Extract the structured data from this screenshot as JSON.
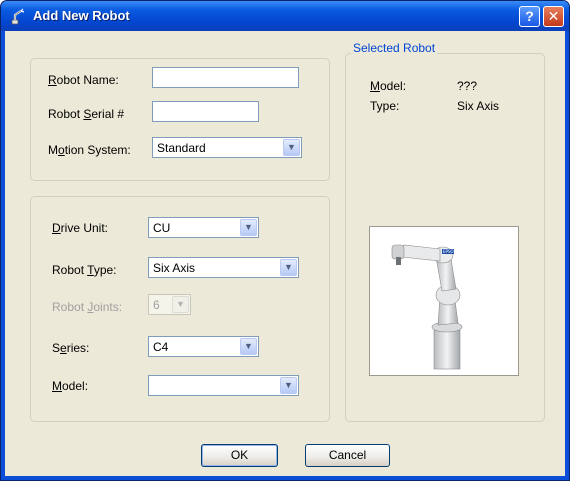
{
  "window": {
    "title": "Add New Robot",
    "help_glyph": "?",
    "close_glyph": "✕"
  },
  "form": {
    "robot_name": {
      "label_pre": "",
      "label_u": "R",
      "label_post": "obot Name:",
      "value": ""
    },
    "robot_serial": {
      "label_pre": "Robot ",
      "label_u": "S",
      "label_post": "erial #",
      "value": ""
    },
    "motion_system": {
      "label_pre": "M",
      "label_u": "o",
      "label_post": "tion System:",
      "value": "Standard"
    },
    "drive_unit": {
      "label_pre": "",
      "label_u": "D",
      "label_post": "rive Unit:",
      "value": "CU"
    },
    "robot_type": {
      "label_pre": "Robot ",
      "label_u": "T",
      "label_post": "ype:",
      "value": "Six Axis"
    },
    "robot_joints": {
      "label_pre": "Robot ",
      "label_u": "J",
      "label_post": "oints:",
      "value": "6"
    },
    "series": {
      "label_pre": "S",
      "label_u": "e",
      "label_post": "ries:",
      "value": "C4"
    },
    "model": {
      "label_pre": "",
      "label_u": "M",
      "label_post": "odel:",
      "value": ""
    }
  },
  "selected_robot": {
    "group_label": "Selected Robot",
    "model_label_u": "M",
    "model_label_post": "odel:",
    "model_value": "???",
    "type_label": "Type:",
    "type_value": "Six Axis",
    "image_brand": "EPSON"
  },
  "buttons": {
    "ok": "OK",
    "cancel": "Cancel"
  },
  "icons": {
    "title": "robot-arm-icon",
    "dropdown": "chevron-down-icon"
  }
}
